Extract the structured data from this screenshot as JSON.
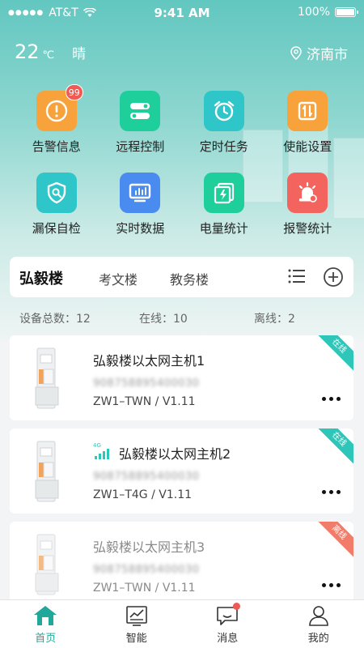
{
  "status_bar": {
    "carrier": "AT&T",
    "time": "9:41 AM",
    "battery": "100%",
    "battery_level": 1.0
  },
  "weather": {
    "temperature": "22",
    "unit": "℃",
    "condition": "晴"
  },
  "location": {
    "city": "济南市",
    "icon": "location-pin-icon"
  },
  "features": [
    {
      "label": "告警信息",
      "icon": "alarm-warning-icon",
      "color": "#f7a23b",
      "badge": "99"
    },
    {
      "label": "远程控制",
      "icon": "toggle-switch-icon",
      "color": "#1fcf9b"
    },
    {
      "label": "定时任务",
      "icon": "alarm-clock-icon",
      "color": "#2ec6c9"
    },
    {
      "label": "使能设置",
      "icon": "enable-settings-icon",
      "color": "#f7a23b"
    },
    {
      "label": "漏保自检",
      "icon": "shield-search-icon",
      "color": "#2ec6c9"
    },
    {
      "label": "实时数据",
      "icon": "monitor-chart-icon",
      "color": "#4a8bf0"
    },
    {
      "label": "电量统计",
      "icon": "power-stats-icon",
      "color": "#1fcf9b"
    },
    {
      "label": "报警统计",
      "icon": "siren-icon",
      "color": "#f4645e"
    }
  ],
  "buildings": {
    "tabs": [
      "弘毅楼",
      "考文楼",
      "教务楼"
    ],
    "active_index": 0,
    "list_icon": "list-icon",
    "add_icon": "add-circle-icon"
  },
  "stats": {
    "total_label": "设备总数：12",
    "online_label": "在线：10",
    "offline_label": "离线：2"
  },
  "devices": [
    {
      "name": "弘毅楼以太网主机1",
      "serial": "908758895400030",
      "model": "ZW1–TWN / V1.11",
      "status": "在线",
      "status_color": "#2ec6b8",
      "signal": false
    },
    {
      "name": "弘毅楼以太网主机2",
      "serial": "908758895400030",
      "model": "ZW1–T4G / V1.11",
      "status": "在线",
      "status_color": "#2ec6b8",
      "signal": true,
      "signal_label": "4G"
    },
    {
      "name": "弘毅楼以太网主机3",
      "serial": "908758895400030",
      "model": "ZW1–TWN / V1.11",
      "status": "离线",
      "status_color": "#f27c6a",
      "signal": false
    }
  ],
  "nav": [
    {
      "label": "首页",
      "icon": "home-icon",
      "active": true
    },
    {
      "label": "智能",
      "icon": "smart-chart-icon",
      "active": false
    },
    {
      "label": "消息",
      "icon": "message-icon",
      "active": false,
      "dot": true
    },
    {
      "label": "我的",
      "icon": "user-icon",
      "active": false
    }
  ],
  "colors": {
    "accent": "#21a89a",
    "hero_top": "#62c7c0"
  }
}
